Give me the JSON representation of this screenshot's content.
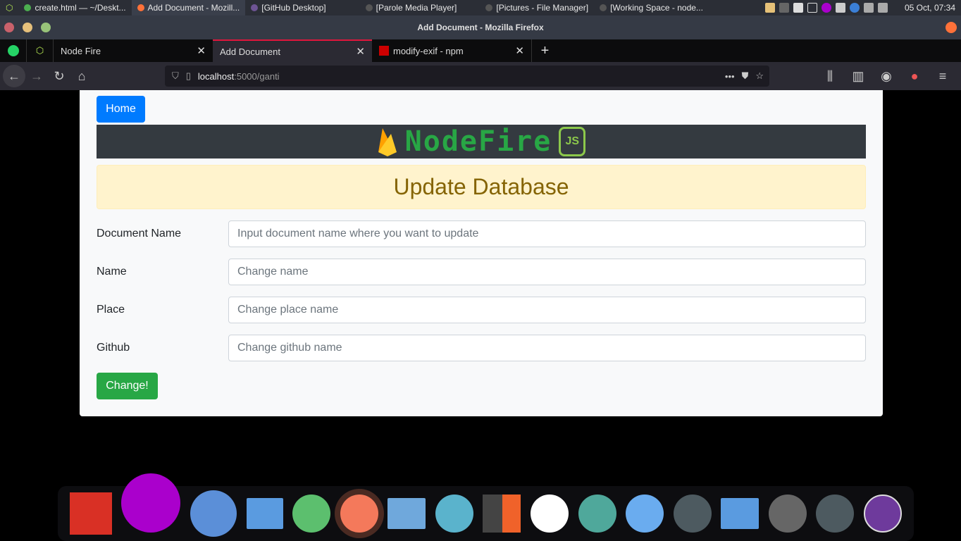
{
  "panel": {
    "tasks": [
      {
        "label": "create.html — ~/Deskt...",
        "color": "#4caf50"
      },
      {
        "label": "Add Document - Mozill...",
        "color": "#ff7139"
      },
      {
        "label": "[GitHub Desktop]",
        "color": "#6e5494"
      },
      {
        "label": "[Parole Media Player]",
        "color": "#555"
      },
      {
        "label": "[Pictures - File Manager]",
        "color": "#555"
      },
      {
        "label": "[Working Space - node...",
        "color": "#555"
      }
    ],
    "clock": "05 Oct, 07:34"
  },
  "window": {
    "title": "Add Document - Mozilla Firefox"
  },
  "tabs": [
    {
      "label": "Node Fire"
    },
    {
      "label": "Add Document",
      "active": true
    },
    {
      "label": "modify-exif - npm"
    }
  ],
  "tab_close": "✕",
  "new_tab": "+",
  "url": {
    "host": "localhost",
    "rest": ":5000/ganti"
  },
  "page": {
    "home_label": "Home",
    "logo_text": "NodeFire",
    "logo_badge": "JS",
    "heading": "Update Database",
    "fields": [
      {
        "label": "Document Name",
        "placeholder": "Input document name where you want to update"
      },
      {
        "label": "Name",
        "placeholder": "Change name"
      },
      {
        "label": "Place",
        "placeholder": "Change place name"
      },
      {
        "label": "Github",
        "placeholder": "Change github name"
      }
    ],
    "submit_label": "Change!",
    "colors": {
      "primary": "#007bff",
      "success": "#28a745",
      "banner": "#343a40",
      "alert_bg": "#fff3cd",
      "alert_text": "#856404"
    }
  },
  "dock": [
    "fritzing",
    "flameshot",
    "chromium",
    "files",
    "notes",
    "firefox",
    "discord",
    "wireshark",
    "sublime-merge",
    "vscode",
    "atom",
    "screenshot",
    "terminal",
    "folder",
    "media-player",
    "terminal-2",
    "github-desktop"
  ]
}
